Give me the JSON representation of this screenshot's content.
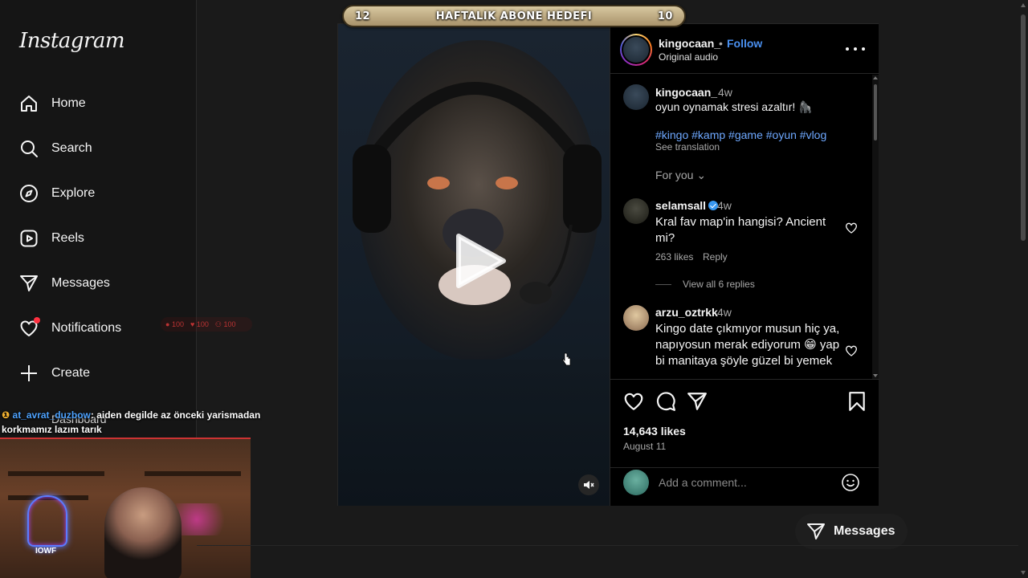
{
  "app": {
    "logo_text": "Instagram"
  },
  "sidebar": {
    "items": [
      {
        "label": "Home",
        "icon": "home-icon"
      },
      {
        "label": "Search",
        "icon": "search-icon"
      },
      {
        "label": "Explore",
        "icon": "compass-icon"
      },
      {
        "label": "Reels",
        "icon": "reels-icon"
      },
      {
        "label": "Messages",
        "icon": "paper-plane-icon"
      },
      {
        "label": "Notifications",
        "icon": "heart-icon"
      },
      {
        "label": "Create",
        "icon": "plus-icon"
      }
    ],
    "notification_stats": {
      "comments": "100",
      "likes": "100",
      "followers": "100"
    },
    "dashboard_label": "Dashboard"
  },
  "stream_overlay": {
    "banner": {
      "left": "12",
      "title": "HAFTALIK ABONE HEDEFI",
      "right": "10"
    },
    "chat": {
      "username": "at_avrat_duzbow",
      "message": ": aiden degilde az önceki yarismadan korkmamız lazım tarık"
    },
    "webcam_logo": "IOWF"
  },
  "post": {
    "author": "kingocaan_",
    "separator": "•",
    "follow_label": "Follow",
    "audio": "Original audio",
    "caption": {
      "user": "kingocaan_",
      "time": "4w",
      "text": "oyun oynamak stresi azaltır! 🦍",
      "tags": "#kingo #kamp #game #oyun #vlog",
      "see_translation": "See translation"
    },
    "for_you_label": "For you",
    "comments": [
      {
        "user": "selamsall",
        "verified": true,
        "time": "4w",
        "text": "Kral fav map'in hangisi? Ancient mi?",
        "likes": "263 likes",
        "reply": "Reply",
        "view_replies": "View all 6 replies"
      },
      {
        "user": "arzu_oztrkk",
        "verified": false,
        "time": "4w",
        "text": "Kingo date çıkmıyor musun hiç ya, napıyosun merak ediyorum 😁 yap bi manitaya şöyle güzel bi yemek"
      }
    ],
    "likes": "14,643 likes",
    "date": "August 11",
    "comment_placeholder": "Add a comment..."
  },
  "floating_messages": {
    "label": "Messages"
  },
  "colors": {
    "link": "#4a90f0",
    "hashtag": "#6ea8ff",
    "notification_dot": "#ff3040",
    "verified": "#3897f0"
  }
}
